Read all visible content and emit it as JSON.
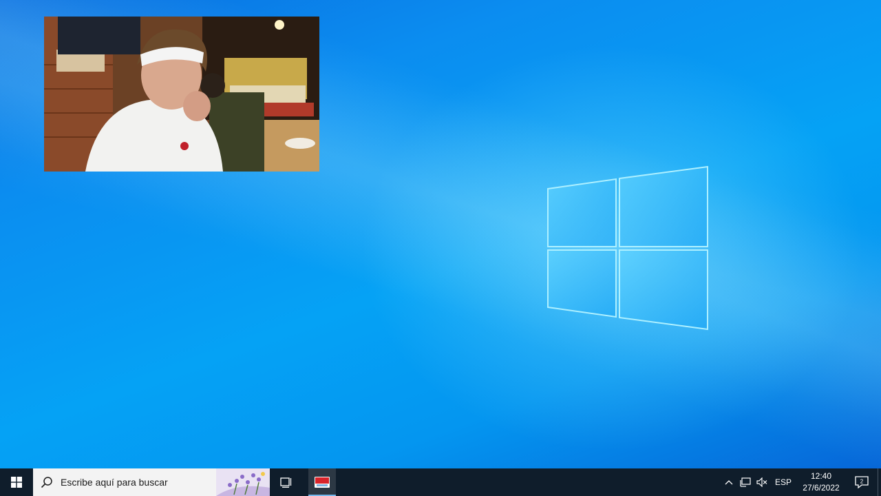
{
  "taskbar": {
    "search_placeholder": "Escribe aquí para buscar",
    "language": "ESP",
    "time": "12:40",
    "date": "27/6/2022",
    "notification_count": "2"
  },
  "icons": {
    "start": "windows-start-icon",
    "search": "search-icon",
    "task_view": "task-view-icon",
    "app": "red-app-icon",
    "tray_chevron": "chevron-up-icon",
    "network": "network-icon",
    "volume": "volume-muted-icon",
    "notifications": "action-center-icon"
  },
  "colors": {
    "taskbar": "#0f1d2b",
    "accent": "#76b9ed",
    "wallpaper": "#0a8ef0"
  }
}
